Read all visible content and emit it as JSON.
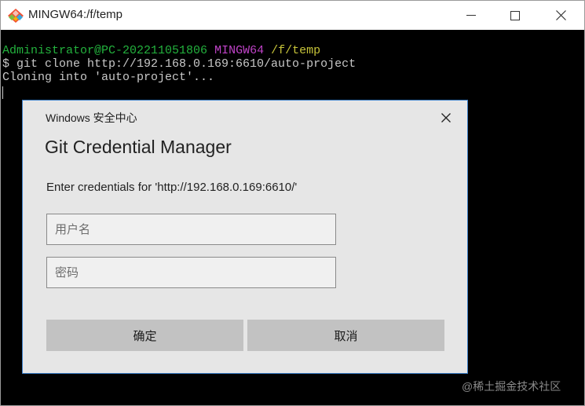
{
  "window": {
    "title": "MINGW64:/f/temp",
    "icon": "git-bash-icon",
    "buttons": [
      "minimize-icon",
      "maximize-icon",
      "close-icon"
    ]
  },
  "terminal": {
    "prompt_user": "Administrator@PC-202211051806",
    "prompt_env": "MINGW64",
    "prompt_path": "/f/temp",
    "command": "$ git clone http://192.168.0.169:6610/auto-project",
    "output": "Cloning into 'auto-project'...",
    "colors": {
      "user": "#23b23d",
      "env": "#c043c8",
      "path": "#c7c43a",
      "text": "#c8c8c8",
      "background": "#000000"
    }
  },
  "dialog": {
    "caption": "Windows 安全中心",
    "heading": "Git Credential Manager",
    "prompt": "Enter credentials for 'http://192.168.0.169:6610/'",
    "username_placeholder": "用户名",
    "password_placeholder": "密码",
    "ok_label": "确定",
    "cancel_label": "取消",
    "border_color": "#3c7fc8"
  },
  "watermark": "@稀土掘金技术社区"
}
